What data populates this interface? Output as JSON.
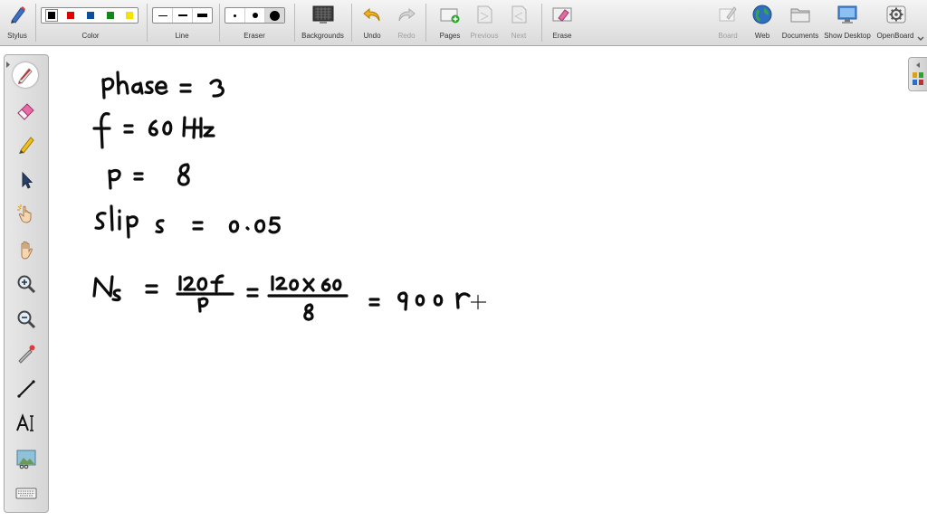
{
  "toolbar": {
    "stylus": "Stylus",
    "color": "Color",
    "line": "Line",
    "eraser": "Eraser",
    "backgrounds": "Backgrounds",
    "undo": "Undo",
    "redo": "Redo",
    "pages": "Pages",
    "previous": "Previous",
    "next": "Next",
    "erase": "Erase",
    "board": "Board",
    "web": "Web",
    "documents": "Documents",
    "show_desktop": "Show Desktop",
    "openboard": "OpenBoard"
  },
  "colors": [
    "#000000",
    "#e00000",
    "#0b4fa0",
    "#0f8a1a",
    "#f4e400"
  ],
  "selected_color": "#000000",
  "sidebar_tools": [
    "pen-icon",
    "eraser-icon",
    "highlighter-icon",
    "selector-icon",
    "interact-hand-icon",
    "pan-hand-icon",
    "zoom-in-icon",
    "zoom-out-icon",
    "laser-pointer-icon",
    "line-icon",
    "text-icon",
    "capture-icon",
    "keyboard-icon"
  ],
  "board": {
    "line1": "phase = 3",
    "line2": "f = 60 Hz",
    "line3": "P = 8",
    "line4": "slip s = 0.05",
    "line5": "Ns = 120f / P = 120 × 60 / 8 = 900 r"
  }
}
